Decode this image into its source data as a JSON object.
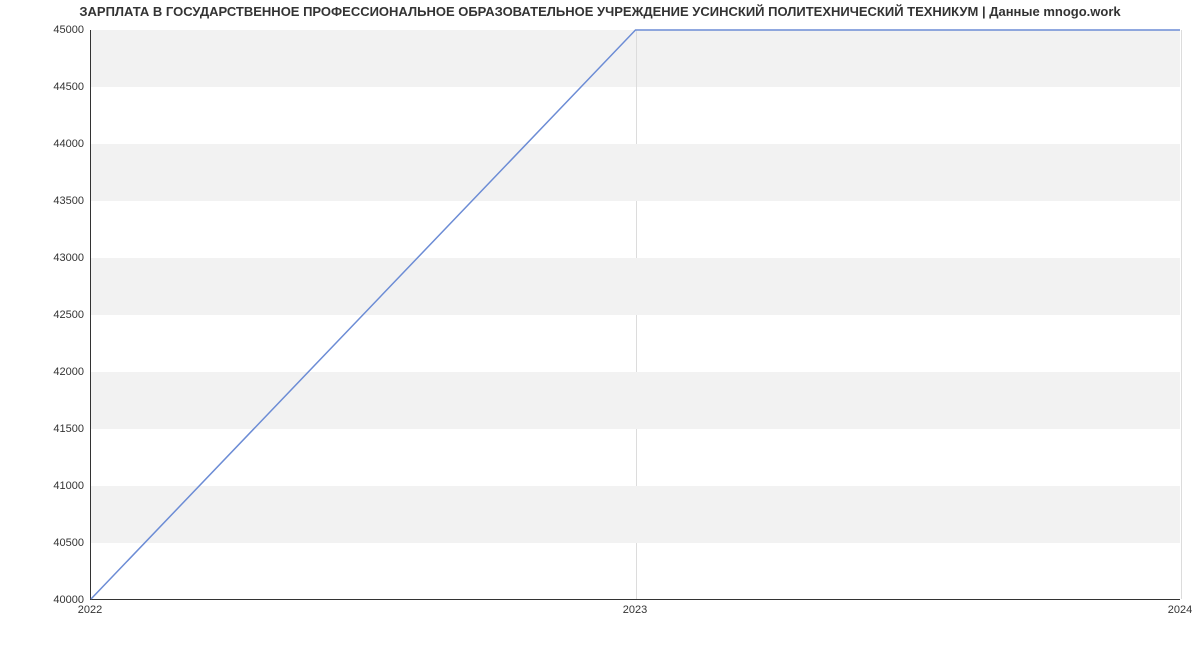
{
  "chart_data": {
    "type": "line",
    "title": "ЗАРПЛАТА В ГОСУДАРСТВЕННОЕ ПРОФЕССИОНАЛЬНОЕ ОБРАЗОВАТЕЛЬНОЕ УЧРЕЖДЕНИЕ УСИНСКИЙ ПОЛИТЕХНИЧЕСКИЙ ТЕХНИКУМ | Данные mnogo.work",
    "x": [
      2022,
      2023,
      2024
    ],
    "values": [
      40000,
      45000,
      45000
    ],
    "xlabel": "",
    "ylabel": "",
    "xlim": [
      2022,
      2024
    ],
    "ylim": [
      40000,
      45000
    ],
    "y_ticks": [
      40000,
      40500,
      41000,
      41500,
      42000,
      42500,
      43000,
      43500,
      44000,
      44500,
      45000
    ],
    "x_ticks": [
      2022,
      2023,
      2024
    ],
    "line_color": "#6c8cd5",
    "band_color": "#f2f2f2"
  }
}
